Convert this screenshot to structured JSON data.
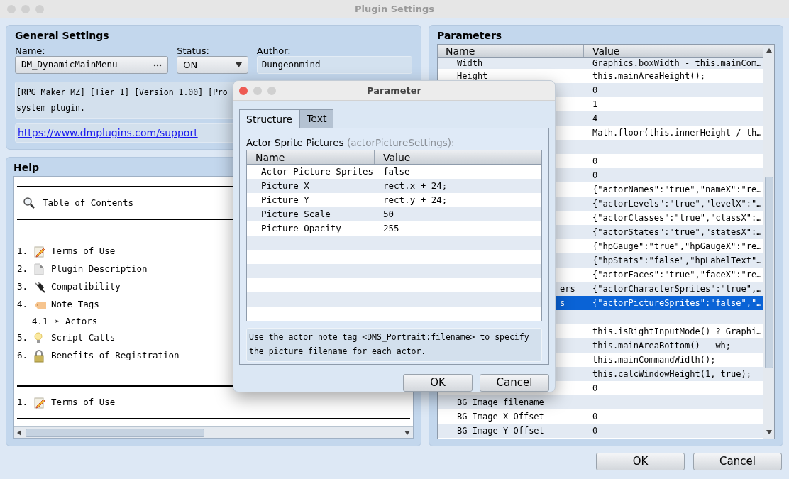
{
  "window": {
    "title": "Plugin Settings"
  },
  "general_settings": {
    "title": "General Settings",
    "name": {
      "label": "Name:",
      "value": "DM_DynamicMainMenu"
    },
    "status": {
      "label": "Status:",
      "value": "ON"
    },
    "author": {
      "label": "Author:",
      "value": "Dungeonmind"
    },
    "description": [
      "[RPG Maker MZ] [Tier 1] [Version 1.00] [Pro",
      "system plugin."
    ],
    "link": "https://www.dmplugins.com/support"
  },
  "help": {
    "title": "Help",
    "toc_title": "Table of Contents",
    "items": [
      {
        "number": "1.",
        "label": "Terms of Use"
      },
      {
        "number": "2.",
        "label": "Plugin Description"
      },
      {
        "number": "3.",
        "label": "Compatibility"
      },
      {
        "number": "4.",
        "label": "Note Tags",
        "children": [
          {
            "number": "4.1",
            "label": "➢ Actors"
          }
        ]
      },
      {
        "number": "5.",
        "label": "Script Calls"
      },
      {
        "number": "6.",
        "label": "Benefits of Registration"
      }
    ],
    "section_heading": {
      "number": "1.",
      "label": "Terms of Use"
    }
  },
  "parameters": {
    "title": "Parameters",
    "columns": [
      "Name",
      "Value"
    ],
    "rows": [
      {
        "name": "Width",
        "value": "Graphics.boxWidth - this.mainCom…",
        "selected": false
      },
      {
        "name": "Height",
        "value": "this.mainAreaHeight();",
        "selected": false
      },
      {
        "value": "0",
        "selected": false
      },
      {
        "value": "1",
        "selected": false
      },
      {
        "value": "4",
        "selected": false
      },
      {
        "value": "Math.floor(this.innerHeight / th…",
        "selected": false
      },
      {
        "selected": false
      },
      {
        "value": "0",
        "selected": false
      },
      {
        "value": "0",
        "selected": false
      },
      {
        "value": "{\"actorNames\":\"true\",\"nameX\":\"re…",
        "selected": false
      },
      {
        "value": "{\"actorLevels\":\"true\",\"levelX\":\"…",
        "selected": false
      },
      {
        "value": "{\"actorClasses\":\"true\",\"classX\":…",
        "selected": false
      },
      {
        "value": "{\"actorStates\":\"true\",\"statesX\":…",
        "selected": false
      },
      {
        "value": "{\"hpGauge\":\"true\",\"hpGaugeX\":\"re…",
        "selected": false
      },
      {
        "value": "{\"hpStats\":\"false\",\"hpLabelText\"…",
        "selected": false
      },
      {
        "value": "{\"actorFaces\":\"true\",\"faceX\":\"re…",
        "selected": false
      },
      {
        "name": "ers",
        "cut_left": true,
        "value": "{\"actorCharacterSprites\":\"true\",…",
        "selected": false
      },
      {
        "name": "s",
        "cut_left": true,
        "value": "{\"actorPictureSprites\":\"false\",\"…",
        "selected": true
      },
      {
        "selected": false
      },
      {
        "value": "this.isRightInputMode() ? Graphi…",
        "selected": false
      },
      {
        "value": "this.mainAreaBottom() - wh;",
        "selected": false
      },
      {
        "value": "this.mainCommandWidth();",
        "selected": false
      },
      {
        "value": "this.calcWindowHeight(1, true);",
        "selected": false
      },
      {
        "value": "0",
        "selected": false
      },
      {
        "name": "BG Image filename",
        "selected": false
      },
      {
        "name": "BG Image X Offset",
        "value": "0",
        "selected": false
      },
      {
        "name": "BG Image Y Offset",
        "value": "0",
        "selected": false
      }
    ]
  },
  "dialog": {
    "title": "Parameter",
    "tabs": [
      {
        "label": "Structure",
        "selected": true
      },
      {
        "label": "Text",
        "selected": false
      }
    ],
    "heading": "Actor Sprite Pictures",
    "key": "(actorPictureSettings):",
    "columns": [
      "Name",
      "Value"
    ],
    "rows": [
      {
        "name": "Actor Picture Sprites",
        "value": "false"
      },
      {
        "name": "Picture X",
        "value": "rect.x + 24;"
      },
      {
        "name": "Picture Y",
        "value": "rect.y + 24;"
      },
      {
        "name": "Picture Scale",
        "value": "50"
      },
      {
        "name": "Picture Opacity",
        "value": "255"
      }
    ],
    "description": "Use the actor note tag <DMS_Portrait:filename> to specify the picture filename for each actor.",
    "buttons": [
      "OK",
      "Cancel"
    ]
  },
  "buttons": [
    "OK",
    "Cancel"
  ]
}
